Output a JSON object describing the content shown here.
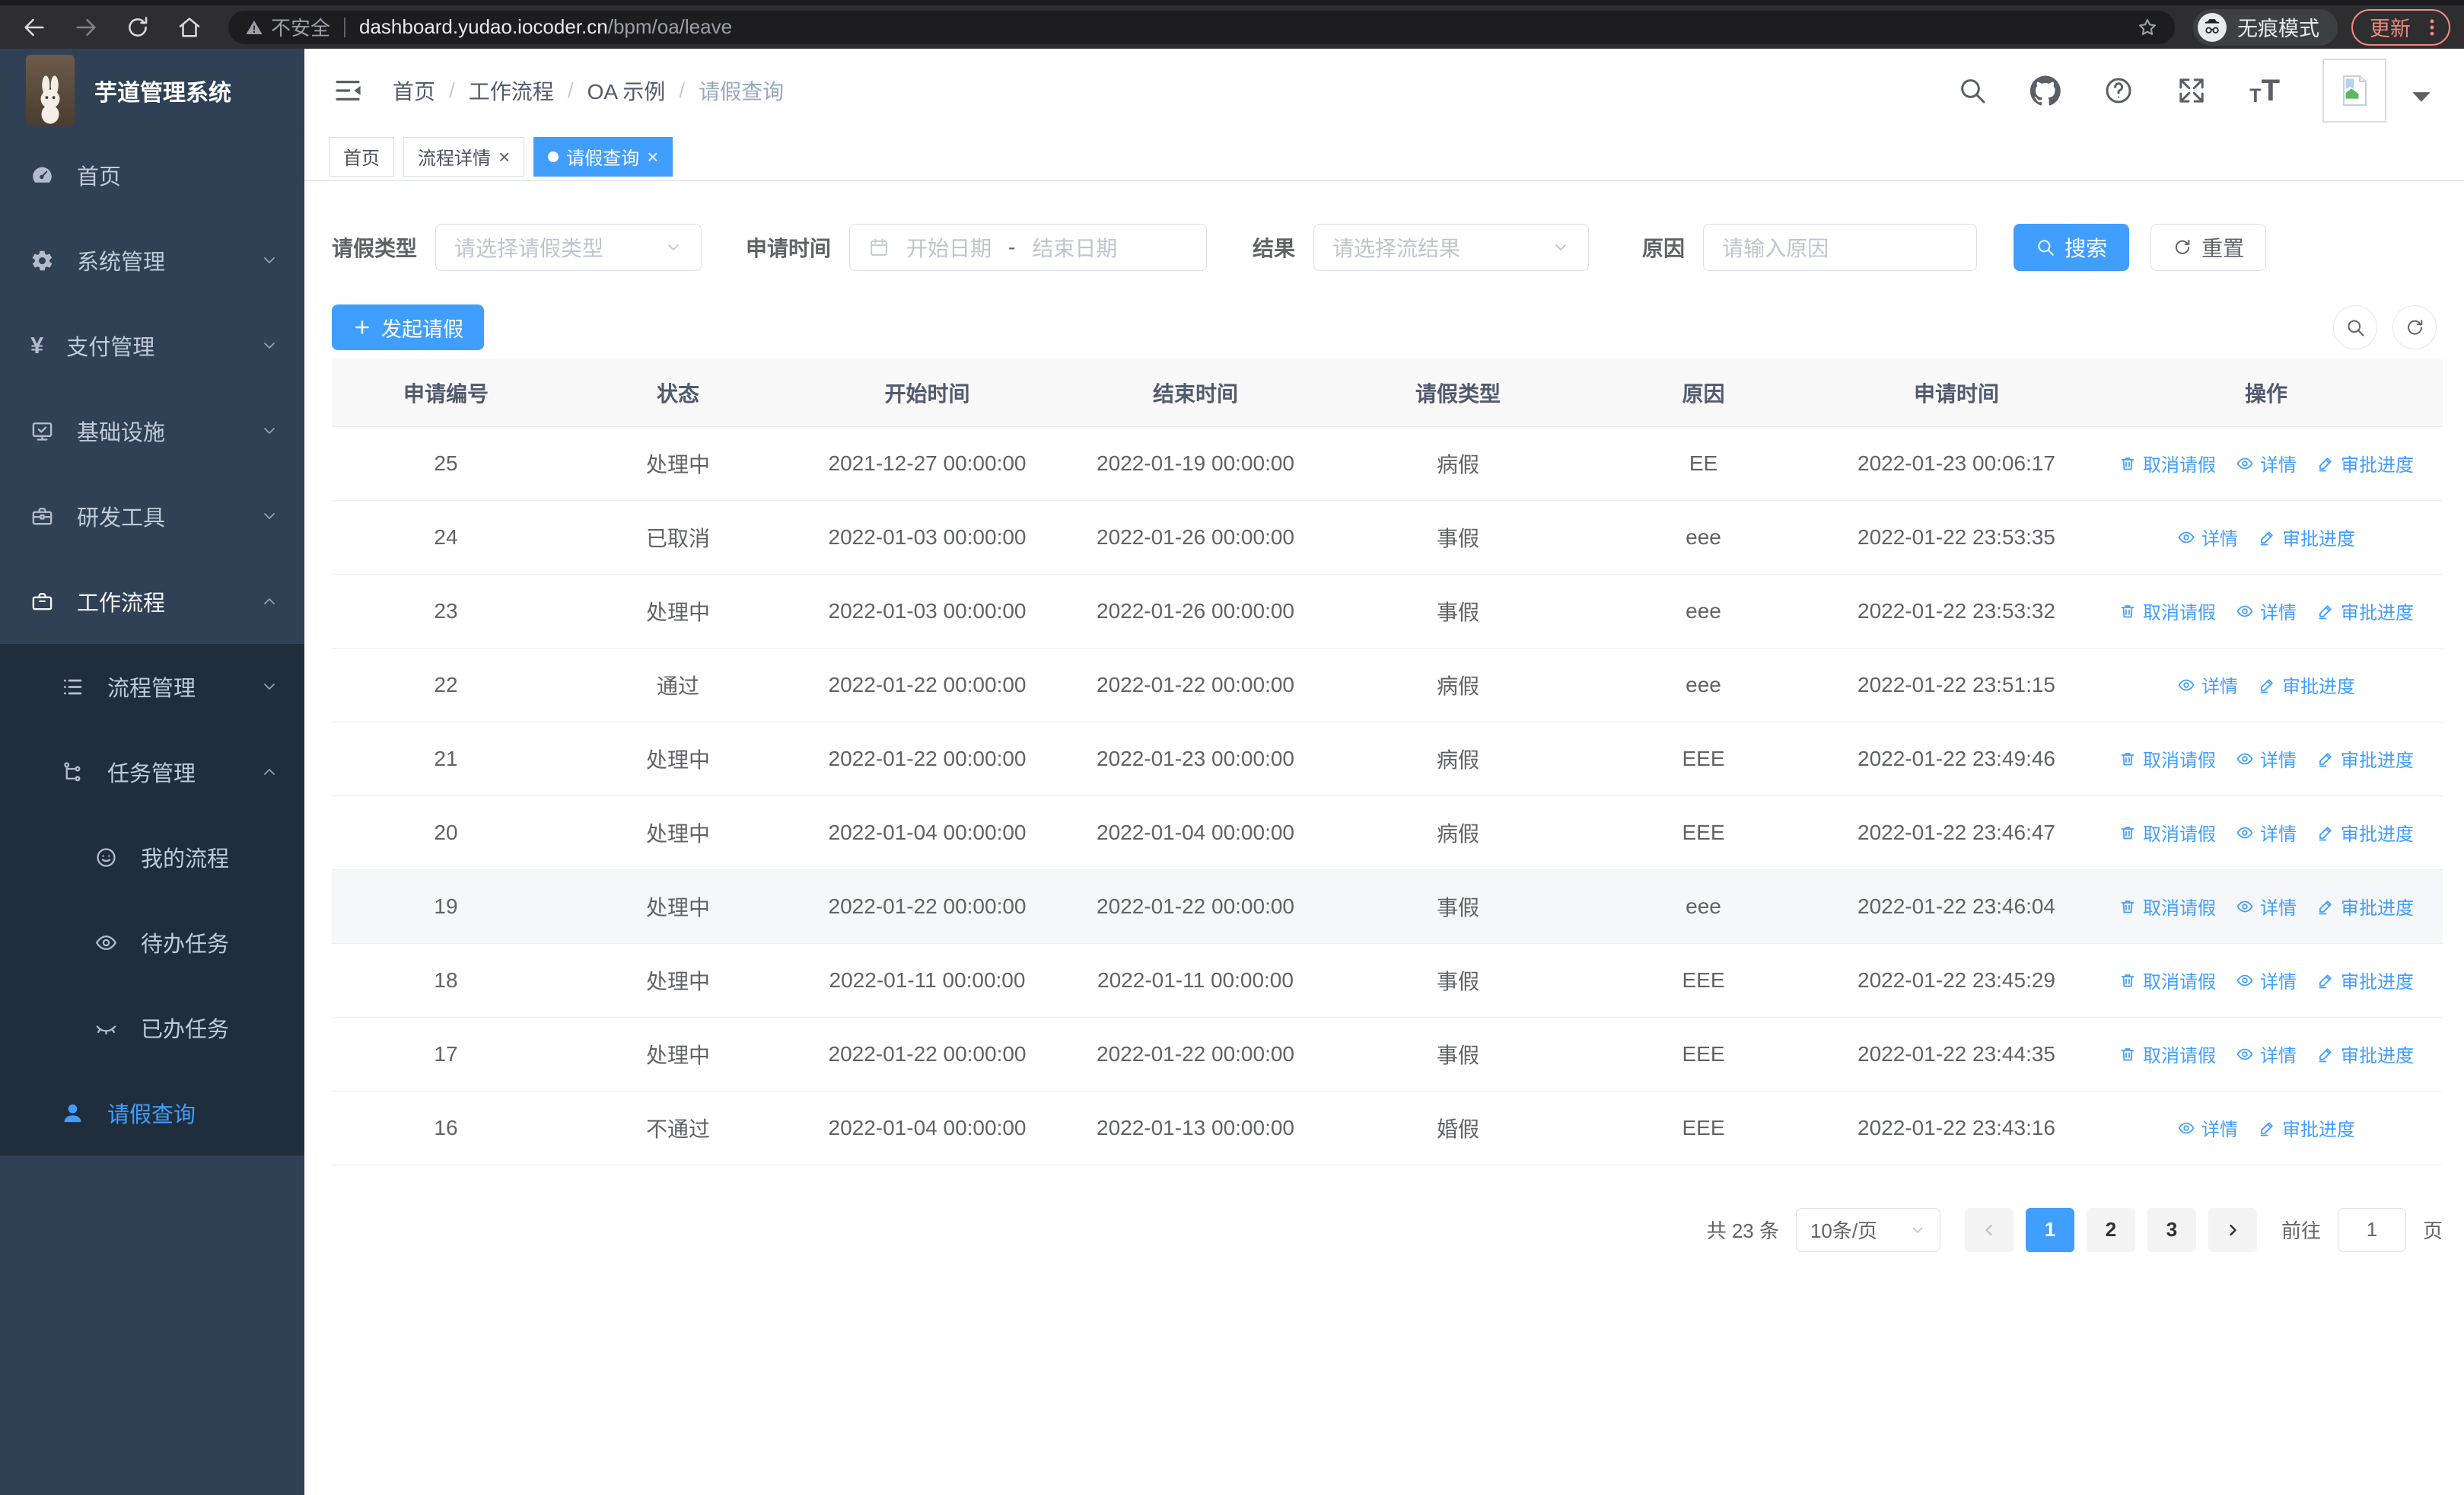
{
  "colors": {
    "primary": "#409eff",
    "sidebar_bg": "#304156",
    "submenu_bg": "#1f2d3d",
    "update_accent": "#f08a7e"
  },
  "browser": {
    "security_label": "不安全",
    "url_host": "dashboard.yudao.iocoder.cn",
    "url_path": "/bpm/oa/leave",
    "incognito_label": "无痕模式",
    "update_label": "更新"
  },
  "app": {
    "title": "芋道管理系统",
    "breadcrumb": [
      "首页",
      "工作流程",
      "OA 示例",
      "请假查询"
    ],
    "tabs": [
      {
        "key": "home",
        "label": "首页",
        "closable": false,
        "active": false
      },
      {
        "key": "process-detail",
        "label": "流程详情",
        "closable": true,
        "active": false
      },
      {
        "key": "leave-query",
        "label": "请假查询",
        "closable": true,
        "active": true
      }
    ]
  },
  "sidebar": {
    "items": [
      {
        "key": "home",
        "label": "首页",
        "icon": "dashboard-icon",
        "level": 1
      },
      {
        "key": "system",
        "label": "系统管理",
        "icon": "gear-icon",
        "level": 1,
        "chevron": "down"
      },
      {
        "key": "payment",
        "label": "支付管理",
        "icon": "yen-icon",
        "level": 1,
        "chevron": "down"
      },
      {
        "key": "infra",
        "label": "基础设施",
        "icon": "monitor-icon",
        "level": 1,
        "chevron": "down"
      },
      {
        "key": "devtools",
        "label": "研发工具",
        "icon": "toolbox-icon",
        "level": 1,
        "chevron": "down"
      },
      {
        "key": "workflow",
        "label": "工作流程",
        "icon": "briefcase-icon",
        "level": 1,
        "chevron": "up",
        "bright": true
      },
      {
        "key": "process-mgmt",
        "label": "流程管理",
        "icon": "list-tree-icon",
        "level": 2,
        "chevron": "down",
        "submenu": true
      },
      {
        "key": "task-mgmt",
        "label": "任务管理",
        "icon": "tree-icon",
        "level": 2,
        "chevron": "up",
        "submenu": true
      },
      {
        "key": "my-process",
        "label": "我的流程",
        "icon": "face-icon",
        "level": 3,
        "submenu": true
      },
      {
        "key": "todo-tasks",
        "label": "待办任务",
        "icon": "eye-icon",
        "level": 3,
        "submenu": true
      },
      {
        "key": "done-tasks",
        "label": "已办任务",
        "icon": "eye-closed-icon",
        "level": 3,
        "submenu": true
      },
      {
        "key": "leave-query",
        "label": "请假查询",
        "icon": "user-icon",
        "level": 2,
        "submenu": true,
        "active": true
      }
    ]
  },
  "filters": {
    "leave_type_label": "请假类型",
    "leave_type_placeholder": "请选择请假类型",
    "apply_time_label": "申请时间",
    "start_date_placeholder": "开始日期",
    "range_separator": "-",
    "end_date_placeholder": "结束日期",
    "result_label": "结果",
    "result_placeholder": "请选择流结果",
    "reason_label": "原因",
    "reason_placeholder": "请输入原因",
    "search_label": "搜索",
    "reset_label": "重置"
  },
  "toolbar": {
    "create_label": "发起请假"
  },
  "table": {
    "columns": [
      "申请编号",
      "状态",
      "开始时间",
      "结束时间",
      "请假类型",
      "原因",
      "申请时间",
      "操作"
    ],
    "action_labels": {
      "cancel": "取消请假",
      "detail": "详情",
      "progress": "审批进度"
    },
    "rows": [
      {
        "id": "25",
        "status": "处理中",
        "start": "2021-12-27 00:00:00",
        "end": "2022-01-19 00:00:00",
        "type": "病假",
        "reason": "EE",
        "applied": "2022-01-23 00:06:17",
        "actions": [
          "cancel",
          "detail",
          "progress"
        ]
      },
      {
        "id": "24",
        "status": "已取消",
        "start": "2022-01-03 00:00:00",
        "end": "2022-01-26 00:00:00",
        "type": "事假",
        "reason": "eee",
        "applied": "2022-01-22 23:53:35",
        "actions": [
          "detail",
          "progress"
        ]
      },
      {
        "id": "23",
        "status": "处理中",
        "start": "2022-01-03 00:00:00",
        "end": "2022-01-26 00:00:00",
        "type": "事假",
        "reason": "eee",
        "applied": "2022-01-22 23:53:32",
        "actions": [
          "cancel",
          "detail",
          "progress"
        ]
      },
      {
        "id": "22",
        "status": "通过",
        "start": "2022-01-22 00:00:00",
        "end": "2022-01-22 00:00:00",
        "type": "病假",
        "reason": "eee",
        "applied": "2022-01-22 23:51:15",
        "actions": [
          "detail",
          "progress"
        ]
      },
      {
        "id": "21",
        "status": "处理中",
        "start": "2022-01-22 00:00:00",
        "end": "2022-01-23 00:00:00",
        "type": "病假",
        "reason": "EEE",
        "applied": "2022-01-22 23:49:46",
        "actions": [
          "cancel",
          "detail",
          "progress"
        ]
      },
      {
        "id": "20",
        "status": "处理中",
        "start": "2022-01-04 00:00:00",
        "end": "2022-01-04 00:00:00",
        "type": "病假",
        "reason": "EEE",
        "applied": "2022-01-22 23:46:47",
        "actions": [
          "cancel",
          "detail",
          "progress"
        ]
      },
      {
        "id": "19",
        "status": "处理中",
        "start": "2022-01-22 00:00:00",
        "end": "2022-01-22 00:00:00",
        "type": "事假",
        "reason": "eee",
        "applied": "2022-01-22 23:46:04",
        "actions": [
          "cancel",
          "detail",
          "progress"
        ],
        "highlighted": true
      },
      {
        "id": "18",
        "status": "处理中",
        "start": "2022-01-11 00:00:00",
        "end": "2022-01-11 00:00:00",
        "type": "事假",
        "reason": "EEE",
        "applied": "2022-01-22 23:45:29",
        "actions": [
          "cancel",
          "detail",
          "progress"
        ]
      },
      {
        "id": "17",
        "status": "处理中",
        "start": "2022-01-22 00:00:00",
        "end": "2022-01-22 00:00:00",
        "type": "事假",
        "reason": "EEE",
        "applied": "2022-01-22 23:44:35",
        "actions": [
          "cancel",
          "detail",
          "progress"
        ]
      },
      {
        "id": "16",
        "status": "不通过",
        "start": "2022-01-04 00:00:00",
        "end": "2022-01-13 00:00:00",
        "type": "婚假",
        "reason": "EEE",
        "applied": "2022-01-22 23:43:16",
        "actions": [
          "detail",
          "progress"
        ]
      }
    ]
  },
  "pagination": {
    "total_label": "共 23 条",
    "page_size": "10条/页",
    "pages": [
      "1",
      "2",
      "3"
    ],
    "active_page": "1",
    "goto_label": "前往",
    "goto_value": "1",
    "page_unit": "页"
  }
}
